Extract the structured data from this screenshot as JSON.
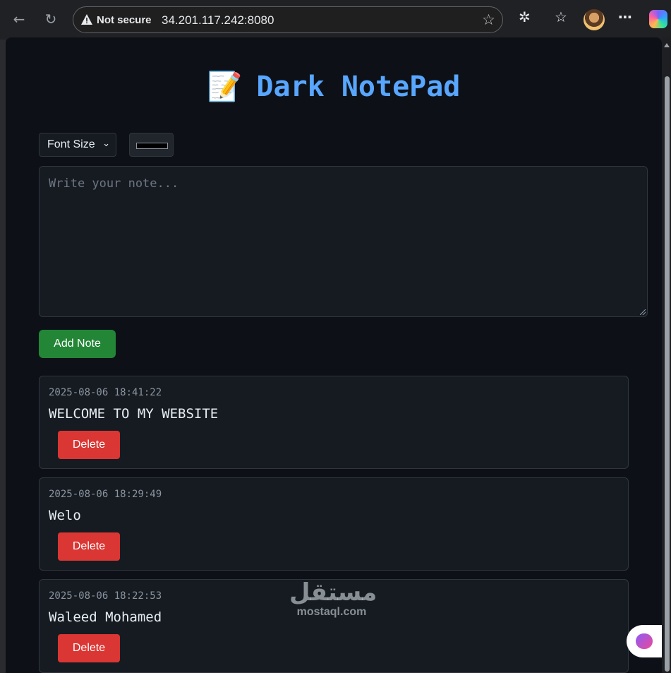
{
  "browser": {
    "security_label": "Not secure",
    "url": "34.201.117.242:8080"
  },
  "app": {
    "title": "Dark NotePad",
    "title_emoji": "📝"
  },
  "toolbar": {
    "font_size_label": "Font Size",
    "color_value": "#000000"
  },
  "editor": {
    "placeholder": "Write your note...",
    "value": ""
  },
  "add_button_label": "Add Note",
  "notes": [
    {
      "timestamp": "2025-08-06 18:41:22",
      "text": "WELCOME TO MY WEBSITE",
      "delete_label": "Delete"
    },
    {
      "timestamp": "2025-08-06 18:29:49",
      "text": "Welo",
      "delete_label": "Delete"
    },
    {
      "timestamp": "2025-08-06 18:22:53",
      "text": "Waleed Mohamed",
      "delete_label": "Delete"
    }
  ],
  "watermark": {
    "arabic": "مستقل",
    "latin": "mostaql.com"
  },
  "colors": {
    "page_bg": "#0d1117",
    "accent": "#58a6ff",
    "add_button": "#238636",
    "delete_button": "#da3633"
  }
}
